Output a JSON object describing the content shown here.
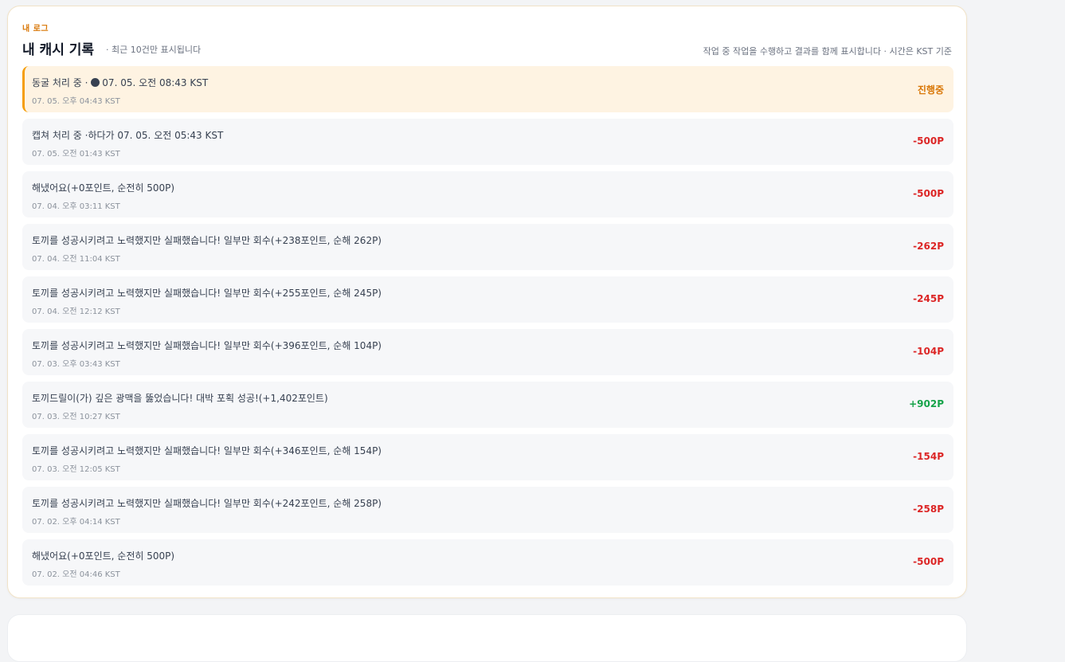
{
  "log": {
    "eyebrow": "내 로그",
    "title": "내 캐시 기록",
    "subtitle": "· 최근 10건만 표시됩니다",
    "note": "작업 중 작업을 수행하고 결과를 함께 표시합니다 · 시간은 KST 기준",
    "colors": {
      "accent": "#d97706",
      "negative": "#dc2626",
      "positive": "#16a34a",
      "active_bg": "#fef3e2"
    },
    "entries": [
      {
        "message_prefix": "동굴 처리 중 ·",
        "icon": "status-dot-icon",
        "message": "07. 05. 오전 08:43 KST",
        "time": "07. 05. 오후 04:43 KST",
        "amount": "진행중",
        "status": "pending"
      },
      {
        "message": "캡쳐 처리 중 ·하다가 07. 05. 오전 05:43 KST",
        "time": "07. 05. 오전 01:43 KST",
        "amount": "-500P",
        "status": "negative"
      },
      {
        "message": "해냈어요(+0포인트, 순전히 500P)",
        "time": "07. 04. 오후 03:11 KST",
        "amount": "-500P",
        "status": "negative"
      },
      {
        "message": "토끼를 성공시키려고 노력했지만 실패했습니다! 일부만 회수(+238포인트, 순해 262P)",
        "time": "07. 04. 오전 11:04 KST",
        "amount": "-262P",
        "status": "negative"
      },
      {
        "message": "토끼를 성공시키려고 노력했지만 실패했습니다! 일부만 회수(+255포인트, 순해 245P)",
        "time": "07. 04. 오전 12:12 KST",
        "amount": "-245P",
        "status": "negative"
      },
      {
        "message": "토끼를 성공시키려고 노력했지만 실패했습니다! 일부만 회수(+396포인트, 순해 104P)",
        "time": "07. 03. 오후 03:43 KST",
        "amount": "-104P",
        "status": "negative"
      },
      {
        "message": "토끼드릴이(가) 깊은 광맥을 뚫었습니다! 대박 포획 성공!(+1,402포인트)",
        "time": "07. 03. 오전 10:27 KST",
        "amount": "+902P",
        "status": "positive"
      },
      {
        "message": "토끼를 성공시키려고 노력했지만 실패했습니다! 일부만 회수(+346포인트, 순해 154P)",
        "time": "07. 03. 오전 12:05 KST",
        "amount": "-154P",
        "status": "negative"
      },
      {
        "message": "토끼를 성공시키려고 노력했지만 실패했습니다! 일부만 회수(+242포인트, 순해 258P)",
        "time": "07. 02. 오후 04:14 KST",
        "amount": "-258P",
        "status": "negative"
      },
      {
        "message": "해냈어요(+0포인트, 순전히 500P)",
        "time": "07. 02. 오전 04:46 KST",
        "amount": "-500P",
        "status": "negative"
      }
    ]
  }
}
